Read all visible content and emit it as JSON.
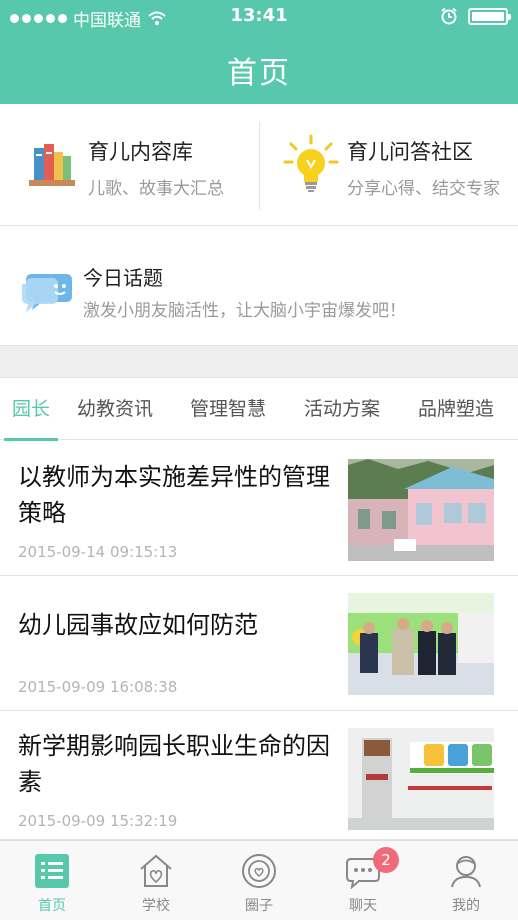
{
  "status_bar": {
    "carrier": "中国联通",
    "time": "13:41"
  },
  "header": {
    "title": "首页"
  },
  "features": [
    {
      "title": "育儿内容库",
      "subtitle": "儿歌、故事大汇总",
      "icon": "books-icon"
    },
    {
      "title": "育儿问答社区",
      "subtitle": "分享心得、结交专家",
      "icon": "lightbulb-icon"
    }
  ],
  "daily_topic": {
    "title": "今日话题",
    "subtitle": "激发小朋友脑活性，让大脑小宇宙爆发吧！",
    "icon": "chat-bubble-icon"
  },
  "category_tabs": [
    {
      "label": "园长",
      "active": true
    },
    {
      "label": "幼教资讯",
      "active": false
    },
    {
      "label": "管理智慧",
      "active": false
    },
    {
      "label": "活动方案",
      "active": false
    },
    {
      "label": "品牌塑造",
      "active": false
    }
  ],
  "articles": [
    {
      "headline": "以教师为本实施差异性的管理策略",
      "date": "2015-09-14 09:15:13"
    },
    {
      "headline": "幼儿园事故应如何防范",
      "date": "2015-09-09 16:08:38"
    },
    {
      "headline": "新学期影响园长职业生命的因素",
      "date": "2015-09-09 15:32:19"
    }
  ],
  "bottom_tabs": [
    {
      "label": "首页",
      "icon": "home-list-icon",
      "active": true
    },
    {
      "label": "学校",
      "icon": "school-house-icon",
      "active": false
    },
    {
      "label": "圈子",
      "icon": "circle-heart-icon",
      "active": false
    },
    {
      "label": "聊天",
      "icon": "chat-icon",
      "active": false,
      "badge": "2"
    },
    {
      "label": "我的",
      "icon": "profile-icon",
      "active": false
    }
  ],
  "colors": {
    "brand": "#58c8ad",
    "badge": "#f06b7a"
  }
}
